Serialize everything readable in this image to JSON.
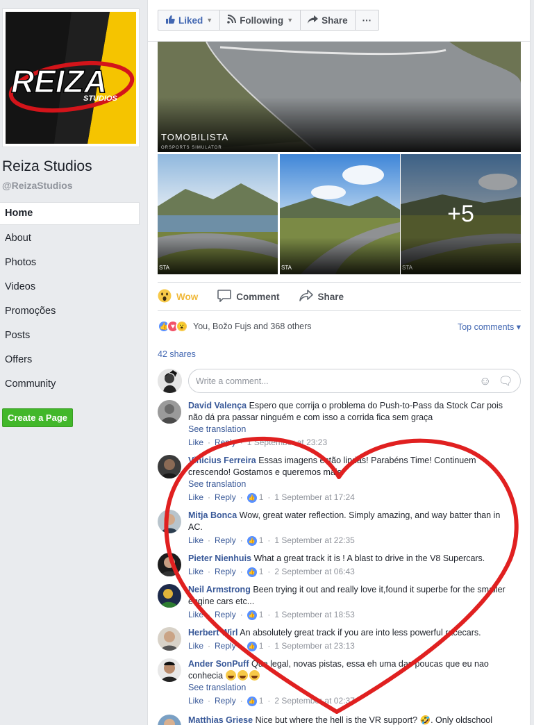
{
  "page": {
    "name": "Reiza Studios",
    "handle": "@ReizaStudios",
    "logo_text": "REIZA",
    "logo_sub": "STUDIOS"
  },
  "nav": {
    "items": [
      {
        "label": "Home",
        "active": true
      },
      {
        "label": "About"
      },
      {
        "label": "Photos"
      },
      {
        "label": "Videos"
      },
      {
        "label": "Promoções"
      },
      {
        "label": "Posts"
      },
      {
        "label": "Offers"
      },
      {
        "label": "Community"
      }
    ],
    "create_page": "Create a Page"
  },
  "actions": {
    "liked": "Liked",
    "following": "Following",
    "share": "Share",
    "more": "···"
  },
  "post": {
    "image_caption": "TOMOBILISTA",
    "image_caption_sub": "ORSPORTS SIMULATOR",
    "thumb_caption": "STA",
    "more_count": "+5",
    "reactions": {
      "wow": "Wow",
      "comment": "Comment",
      "share": "Share"
    },
    "summary": "You, Božo Fujs and 368 others",
    "top_comments": "Top comments ▾",
    "shares": "42 shares",
    "comment_placeholder": "Write a comment..."
  },
  "comments": [
    {
      "author": "David Valença",
      "text": "Espero que corrija o problema do Push-to-Pass da Stock Car pois não dá pra passar ninguém e com isso a corrida fica sem graça",
      "translation": "See translation",
      "likes": "",
      "time": "1 September at 23:23"
    },
    {
      "author": "Vinicius Ferreira",
      "text": "Essas imagens estão lindas! Parabéns Time! Continuem crescendo! Gostamos e queremos mais!",
      "translation": "See translation",
      "likes": "1",
      "time": "1 September at 17:24"
    },
    {
      "author": "Mitja Bonca",
      "text": "Wow, great water reflection. Simply amazing, and way batter than in AC.",
      "translation": "",
      "likes": "1",
      "time": "1 September at 22:35"
    },
    {
      "author": "Pieter Nienhuis",
      "text": "What a great track it is ! A blast to drive in the V8 Supercars.",
      "translation": "",
      "likes": "1",
      "time": "2 September at 06:43"
    },
    {
      "author": "Neil Armstrong",
      "text": "Been trying it out and really love it,found it superbe for the smaller engine cars etc...",
      "translation": "",
      "likes": "1",
      "time": "1 September at 18:53"
    },
    {
      "author": "Herbert Wirl",
      "text": "An absolutely great track if you are into less powerful racecars.",
      "translation": "",
      "likes": "1",
      "time": "1 September at 23:13"
    },
    {
      "author": "Ander SonPuff",
      "text": "Que legal, novas pistas, essa eh uma das poucas que eu nao conhecia",
      "translation": "See translation",
      "likes": "1",
      "time": "2 September at 02:37"
    },
    {
      "author": "Matthias Griese",
      "text": "Nice but where the hell is the VR support? 🤣. Only oldschool",
      "translation": "",
      "likes": "",
      "time": ""
    }
  ],
  "meta_labels": {
    "like": "Like",
    "reply": "Reply",
    "dot": "·"
  },
  "colors": {
    "fb_blue": "#4267b2",
    "link_blue": "#385898",
    "wow_yellow": "#f0b93b",
    "green": "#42b72a",
    "heart_red": "#e02020"
  }
}
